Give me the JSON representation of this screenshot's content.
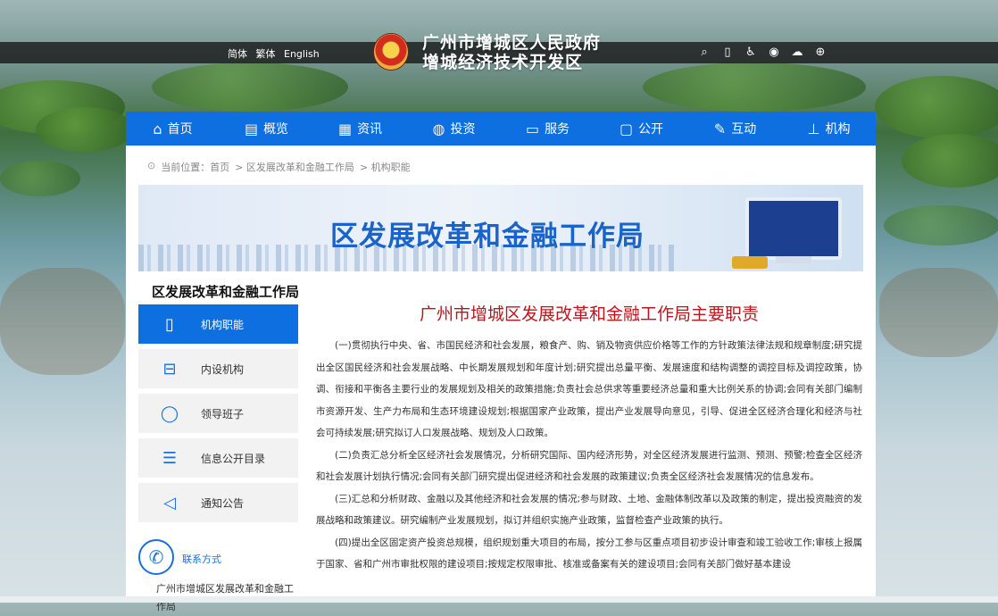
{
  "header": {
    "lang": [
      "简体",
      "繁体",
      "English"
    ],
    "title_line1": "广州市增城区人民政府",
    "title_line2": "增城经济技术开发区",
    "tools": [
      "search-icon",
      "mobile-icon",
      "accessibility-icon",
      "weibo-icon",
      "wechat-icon",
      "app-icon"
    ]
  },
  "nav": [
    {
      "label": "首页",
      "icon": "home-icon"
    },
    {
      "label": "概览",
      "icon": "overview-icon"
    },
    {
      "label": "资讯",
      "icon": "news-icon"
    },
    {
      "label": "投资",
      "icon": "globe-icon"
    },
    {
      "label": "服务",
      "icon": "briefcase-icon"
    },
    {
      "label": "公开",
      "icon": "monitor-icon"
    },
    {
      "label": "互动",
      "icon": "chat-icon"
    },
    {
      "label": "机构",
      "icon": "org-icon"
    }
  ],
  "breadcrumb": {
    "prefix": "当前位置：首页",
    "items": [
      "> 区发展改革和金融工作局",
      "> 机构职能"
    ]
  },
  "banner": {
    "title": "区发展改革和金融工作局"
  },
  "sidebar": {
    "title": "区发展改革和金融工作局",
    "items": [
      {
        "label": "机构职能",
        "icon": "document-icon",
        "active": true
      },
      {
        "label": "内设机构",
        "icon": "inbox-icon",
        "active": false
      },
      {
        "label": "领导班子",
        "icon": "user-icon",
        "active": false
      },
      {
        "label": "信息公开目录",
        "icon": "list-icon",
        "active": false
      },
      {
        "label": "通知公告",
        "icon": "speaker-icon",
        "active": false
      }
    ],
    "contact_label": "联系方式",
    "contact_text": "广州市增城区发展改革和金融工作局"
  },
  "article": {
    "title": "广州市增城区发展改革和金融工作局主要职责",
    "paragraphs": [
      "(一)贯彻执行中央、省、市国民经济和社会发展，粮食产、购、销及物资供应价格等工作的方针政策法律法规和规章制度;研究提出全区国民经济和社会发展战略、中长期发展规划和年度计划;研究提出总量平衡、发展速度和结构调整的调控目标及调控政策，协调、衔接和平衡各主要行业的发展规划及相关的政策措施;负责社会总供求等重要经济总量和重大比例关系的协调;会同有关部门编制市资源开发、生产力布局和生态环境建设规划;根据国家产业政策，提出产业发展导向意见，引导、促进全区经济合理化和经济与社会可持续发展;研究拟订人口发展战略、规划及人口政策。",
      "(二)负责汇总分析全区经济社会发展情况，分析研究国际、国内经济形势，对全区经济发展进行监测、预测、预警;检查全区经济和社会发展计划执行情况;会同有关部门研究提出促进经济和社会发展的政策建议;负责全区经济社会发展情况的信息发布。",
      "(三)汇总和分析财政、金融以及其他经济和社会发展的情况;参与财政、土地、金融体制改革以及政策的制定，提出投资融资的发展战略和政策建议。研究编制产业发展规划，拟订并组织实施产业政策，监督检查产业政策的执行。",
      "(四)提出全区固定资产投资总规模，组织规划重大项目的布局，按分工参与区重点项目初步设计审查和竣工验收工作;审核上报属于国家、省和广州市审批权限的建设项目;按规定权限审批、核准或备案有关的建设项目;会同有关部门做好基本建设"
    ]
  }
}
